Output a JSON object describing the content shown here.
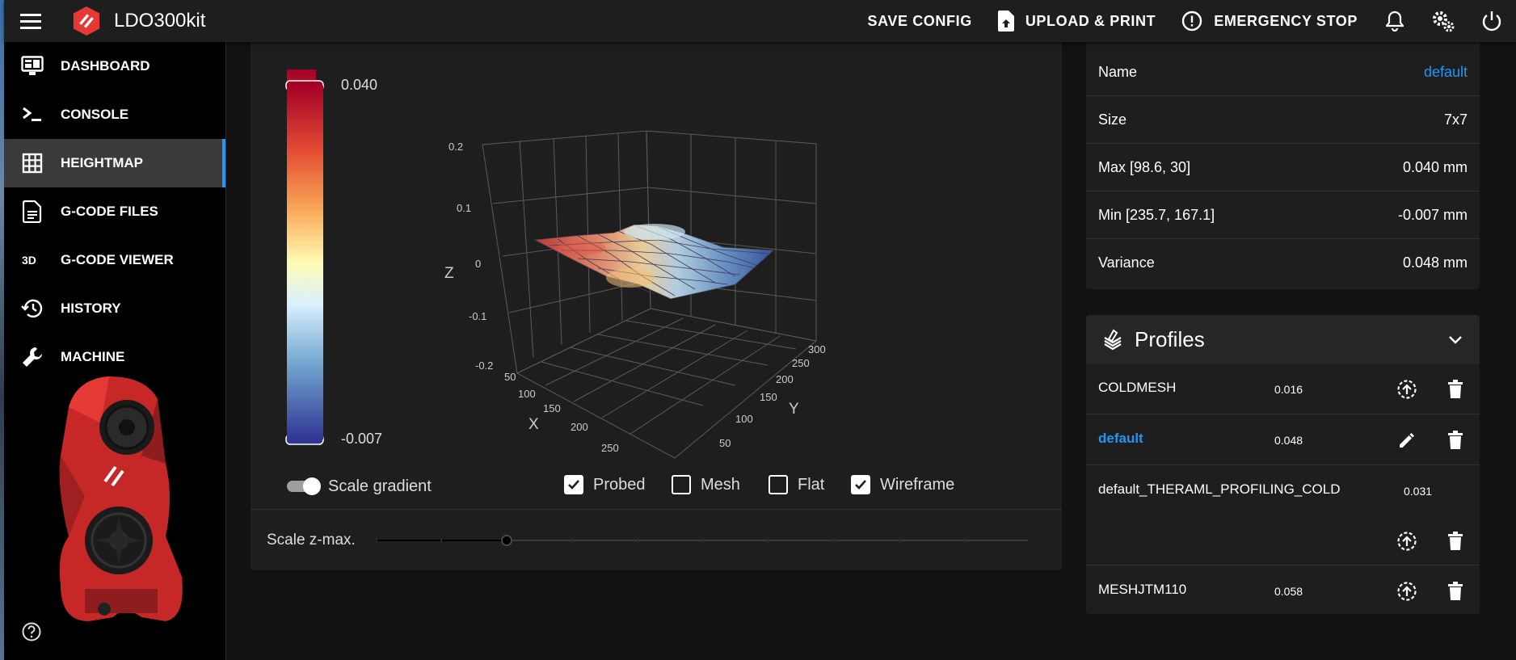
{
  "app": {
    "title": "LDO300kit"
  },
  "topbar": {
    "save_config": "SAVE CONFIG",
    "upload_print": "UPLOAD & PRINT",
    "emergency_stop": "EMERGENCY STOP"
  },
  "sidebar": {
    "items": [
      {
        "label": "DASHBOARD",
        "icon": "monitor-dashboard-icon"
      },
      {
        "label": "CONSOLE",
        "icon": "console-icon"
      },
      {
        "label": "HEIGHTMAP",
        "icon": "grid-icon",
        "active": true
      },
      {
        "label": "G-CODE FILES",
        "icon": "file-document-icon"
      },
      {
        "label": "G-CODE VIEWER",
        "icon": "3d-icon"
      },
      {
        "label": "HISTORY",
        "icon": "history-icon"
      },
      {
        "label": "MACHINE",
        "icon": "wrench-icon"
      }
    ]
  },
  "heightmap": {
    "gradient_max": "0.040",
    "gradient_min": "-0.007",
    "axis": {
      "x_label": "X",
      "y_label": "Y",
      "z_label": "Z"
    },
    "z_ticks": [
      "0.2",
      "0.1",
      "0",
      "-0.1",
      "-0.2"
    ],
    "x_ticks": [
      "50",
      "100",
      "150",
      "200",
      "250"
    ],
    "y_ticks": [
      "50",
      "100",
      "150",
      "200",
      "250",
      "300"
    ],
    "controls": {
      "scale_gradient": "Scale gradient",
      "probed": "Probed",
      "mesh": "Mesh",
      "flat": "Flat",
      "wireframe": "Wireframe",
      "probed_checked": true,
      "mesh_checked": false,
      "flat_checked": false,
      "wireframe_checked": true,
      "scale_gradient_on": true
    },
    "scale_zmax_label": "Scale z-max."
  },
  "mesh_info": {
    "rows": [
      {
        "label": "Name",
        "value": "default"
      },
      {
        "label": "Size",
        "value": "7x7"
      },
      {
        "label": "Max [98.6, 30]",
        "value": "0.040 mm"
      },
      {
        "label": "Min [235.7, 167.1]",
        "value": "-0.007 mm"
      },
      {
        "label": "Variance",
        "value": "0.048 mm"
      }
    ]
  },
  "profiles": {
    "title": "Profiles",
    "items": [
      {
        "name": "COLDMESH",
        "variance": "0.016"
      },
      {
        "name": "default",
        "variance": "0.048"
      },
      {
        "name": "default_THERAML_PROFILING_COLD",
        "variance": "0.031"
      },
      {
        "name": "MESHJTM110",
        "variance": "0.058"
      }
    ]
  },
  "colors": {
    "accent": "#2196f3",
    "logo_red": "#e53935"
  }
}
